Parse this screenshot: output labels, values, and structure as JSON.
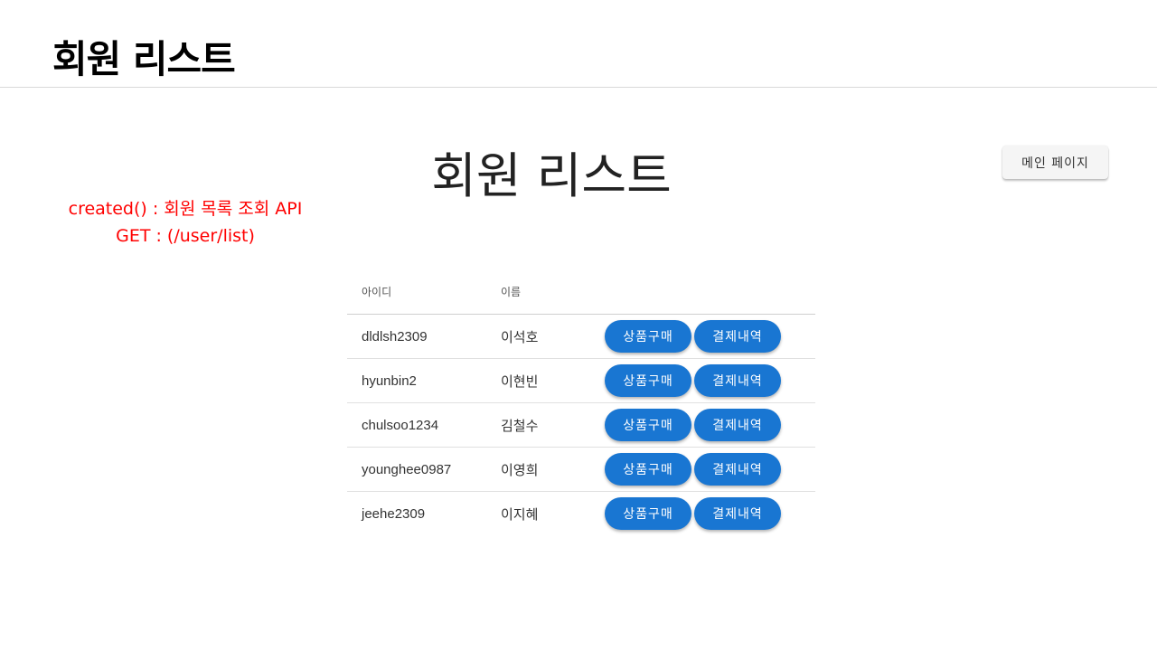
{
  "slide": {
    "title": "회원 리스트"
  },
  "page": {
    "title": "회원 리스트",
    "main_button_label": "메인 페이지"
  },
  "annotation": {
    "line1": "created() : 회원 목록 조회 API",
    "line2": "GET : (/user/list)"
  },
  "table": {
    "headers": {
      "id": "아이디",
      "name": "이름"
    },
    "buy_label": "상품구매",
    "payment_label": "결제내역",
    "rows": [
      {
        "id": "dldlsh2309",
        "name": "이석호"
      },
      {
        "id": "hyunbin2",
        "name": "이현빈"
      },
      {
        "id": "chulsoo1234",
        "name": "김철수"
      },
      {
        "id": "younghee0987",
        "name": "이영희"
      },
      {
        "id": "jeehe2309",
        "name": "이지혜"
      }
    ]
  },
  "colors": {
    "primary": "#1976d2",
    "annotation": "#ff0000"
  }
}
